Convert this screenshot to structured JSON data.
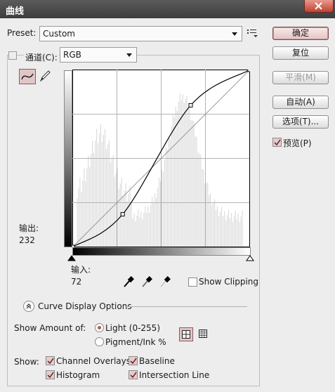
{
  "window": {
    "title": "曲线"
  },
  "preset": {
    "label": "Preset:",
    "value": "Custom"
  },
  "channel": {
    "label": "通道(C):",
    "value": "RGB"
  },
  "buttons": {
    "ok": "确定",
    "reset": "复位",
    "smooth": "平滑(M)",
    "auto": "自动(A)",
    "options": "选项(T)...",
    "preview": "预览(P)"
  },
  "readout": {
    "output_label": "输出:",
    "output_value": "232",
    "input_label": "输入:",
    "input_value": "72"
  },
  "show_clipping": "Show Clipping",
  "curve_display_options": "Curve Display Options",
  "show_amount": {
    "label": "Show Amount of:",
    "light": "Light  (0-255)",
    "pigment": "Pigment/Ink %",
    "selected": "light"
  },
  "show": {
    "label": "Show:",
    "channel_overlays": "Channel Overlays",
    "baseline": "Baseline",
    "histogram": "Histogram",
    "intersection_line": "Intersection Line"
  },
  "curve": {
    "control_points": [
      [
        0,
        0
      ],
      [
        72,
        47
      ],
      [
        170,
        204
      ],
      [
        255,
        255
      ]
    ]
  },
  "colors": {
    "accent": "#a85d5d",
    "titlebar": "#4a4a4a"
  }
}
